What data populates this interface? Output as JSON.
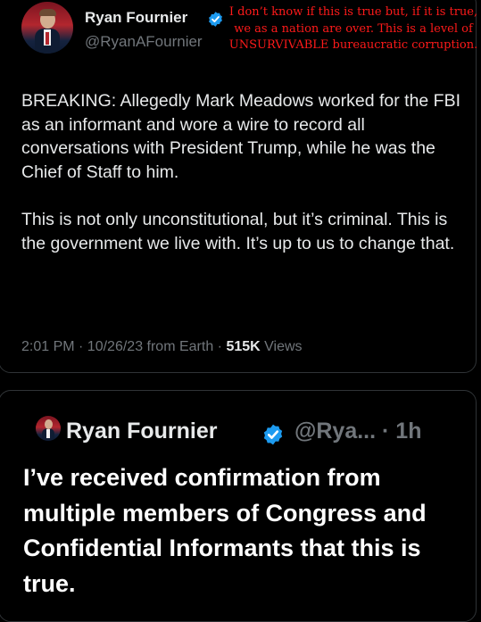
{
  "tweet": {
    "display_name": "Ryan Fournier",
    "handle": "@RyanAFournier",
    "overlay_caption": "I don’t know if this is true but, if it is true, we as a nation are over. This is a level of UNSURVIVABLE bureaucratic corruption.",
    "paragraph1": "BREAKING: Allegedly Mark Meadows worked for the FBI as an informant and wore a wire to record all conversations with President Trump, while he was the Chief of Staff to him.",
    "paragraph2": "This is not only unconstitutional, but it’s criminal. This is the government we live with. It’s up to us to change that.",
    "timestamp": "2:01 PM · 10/26/23 from Earth · ",
    "views_count": "515K",
    "views_label": " Views"
  },
  "reply": {
    "display_name": "Ryan Fournier",
    "handle": "@Rya...",
    "separator": " · ",
    "age": "1h",
    "text": "I’ve received confirmation from multiple members of Congress and Confidential Informants that this is true."
  },
  "colors": {
    "background": "#000000",
    "verified_badge": "#1d9bf0",
    "caption": "#ff1a1a",
    "secondary_text": "#71767b"
  },
  "icons": [
    "verified-badge-icon"
  ]
}
